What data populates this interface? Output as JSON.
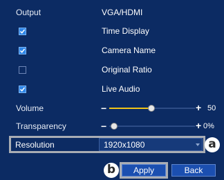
{
  "rows": {
    "output_label": "Output",
    "output_value": "VGA/HDMI",
    "time_display": {
      "label": "Time Display",
      "checked": true
    },
    "camera_name": {
      "label": "Camera Name",
      "checked": true
    },
    "original_ratio": {
      "label": "Original Ratio",
      "checked": false
    },
    "live_audio": {
      "label": "Live Audio",
      "checked": true
    }
  },
  "volume": {
    "label": "Volume",
    "value": "50",
    "minus": "−",
    "plus": "+"
  },
  "transparency": {
    "label": "Transparency",
    "value": "0%",
    "minus": "−",
    "plus": "+"
  },
  "resolution": {
    "label": "Resolution",
    "selected": "1920x1080"
  },
  "callouts": {
    "a": "a",
    "b": "b"
  },
  "buttons": {
    "apply": "Apply",
    "back": "Back"
  },
  "colors": {
    "background": "#0c2b63",
    "checkbox_on": "#2f86e8",
    "slider_fill": "#f2c518",
    "button": "#1b4fb0"
  }
}
